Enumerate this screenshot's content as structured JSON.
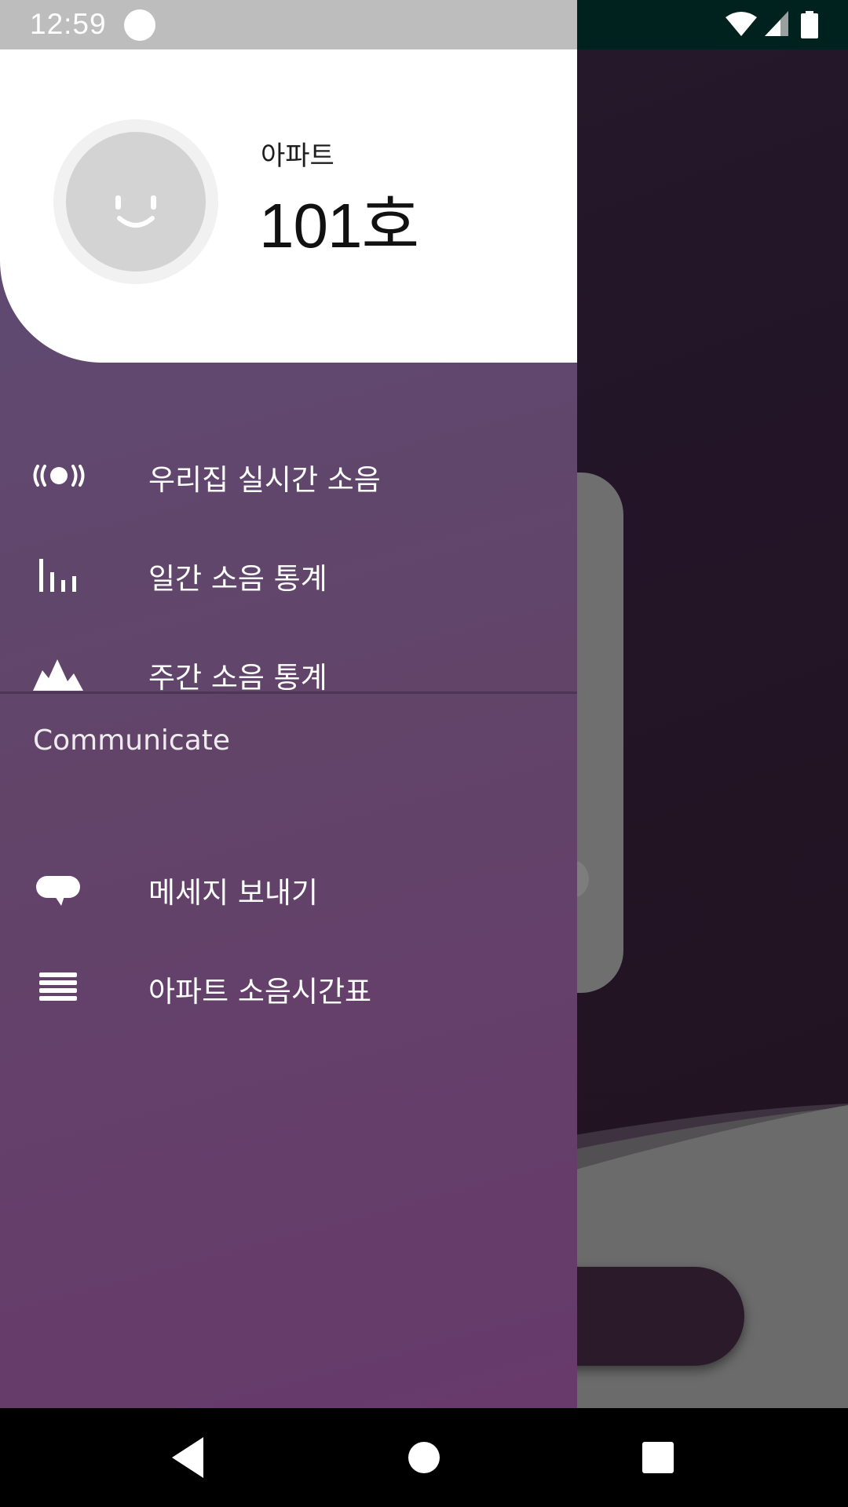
{
  "status_bar": {
    "time": "12:59"
  },
  "drawer": {
    "header": {
      "subtitle": "아파트",
      "title": "101호"
    },
    "menu": [
      {
        "label": "우리집 실시간 소음",
        "icon": "live-broadcast-icon"
      },
      {
        "label": "일간 소음 통계",
        "icon": "bar-chart-icon"
      },
      {
        "label": "주간 소음 통계",
        "icon": "mountain-chart-icon"
      }
    ],
    "section": {
      "title": "Communicate",
      "items": [
        {
          "label": "메세지 보내기",
          "icon": "chat-bubble-icon"
        },
        {
          "label": "아파트 소음시간표",
          "icon": "list-lines-icon"
        }
      ]
    }
  },
  "colors": {
    "drawer_top": "#5f4c74",
    "drawer_bottom": "#673a6b",
    "status_bar_right": "#00221e",
    "avatar": "#d3d3d3"
  }
}
